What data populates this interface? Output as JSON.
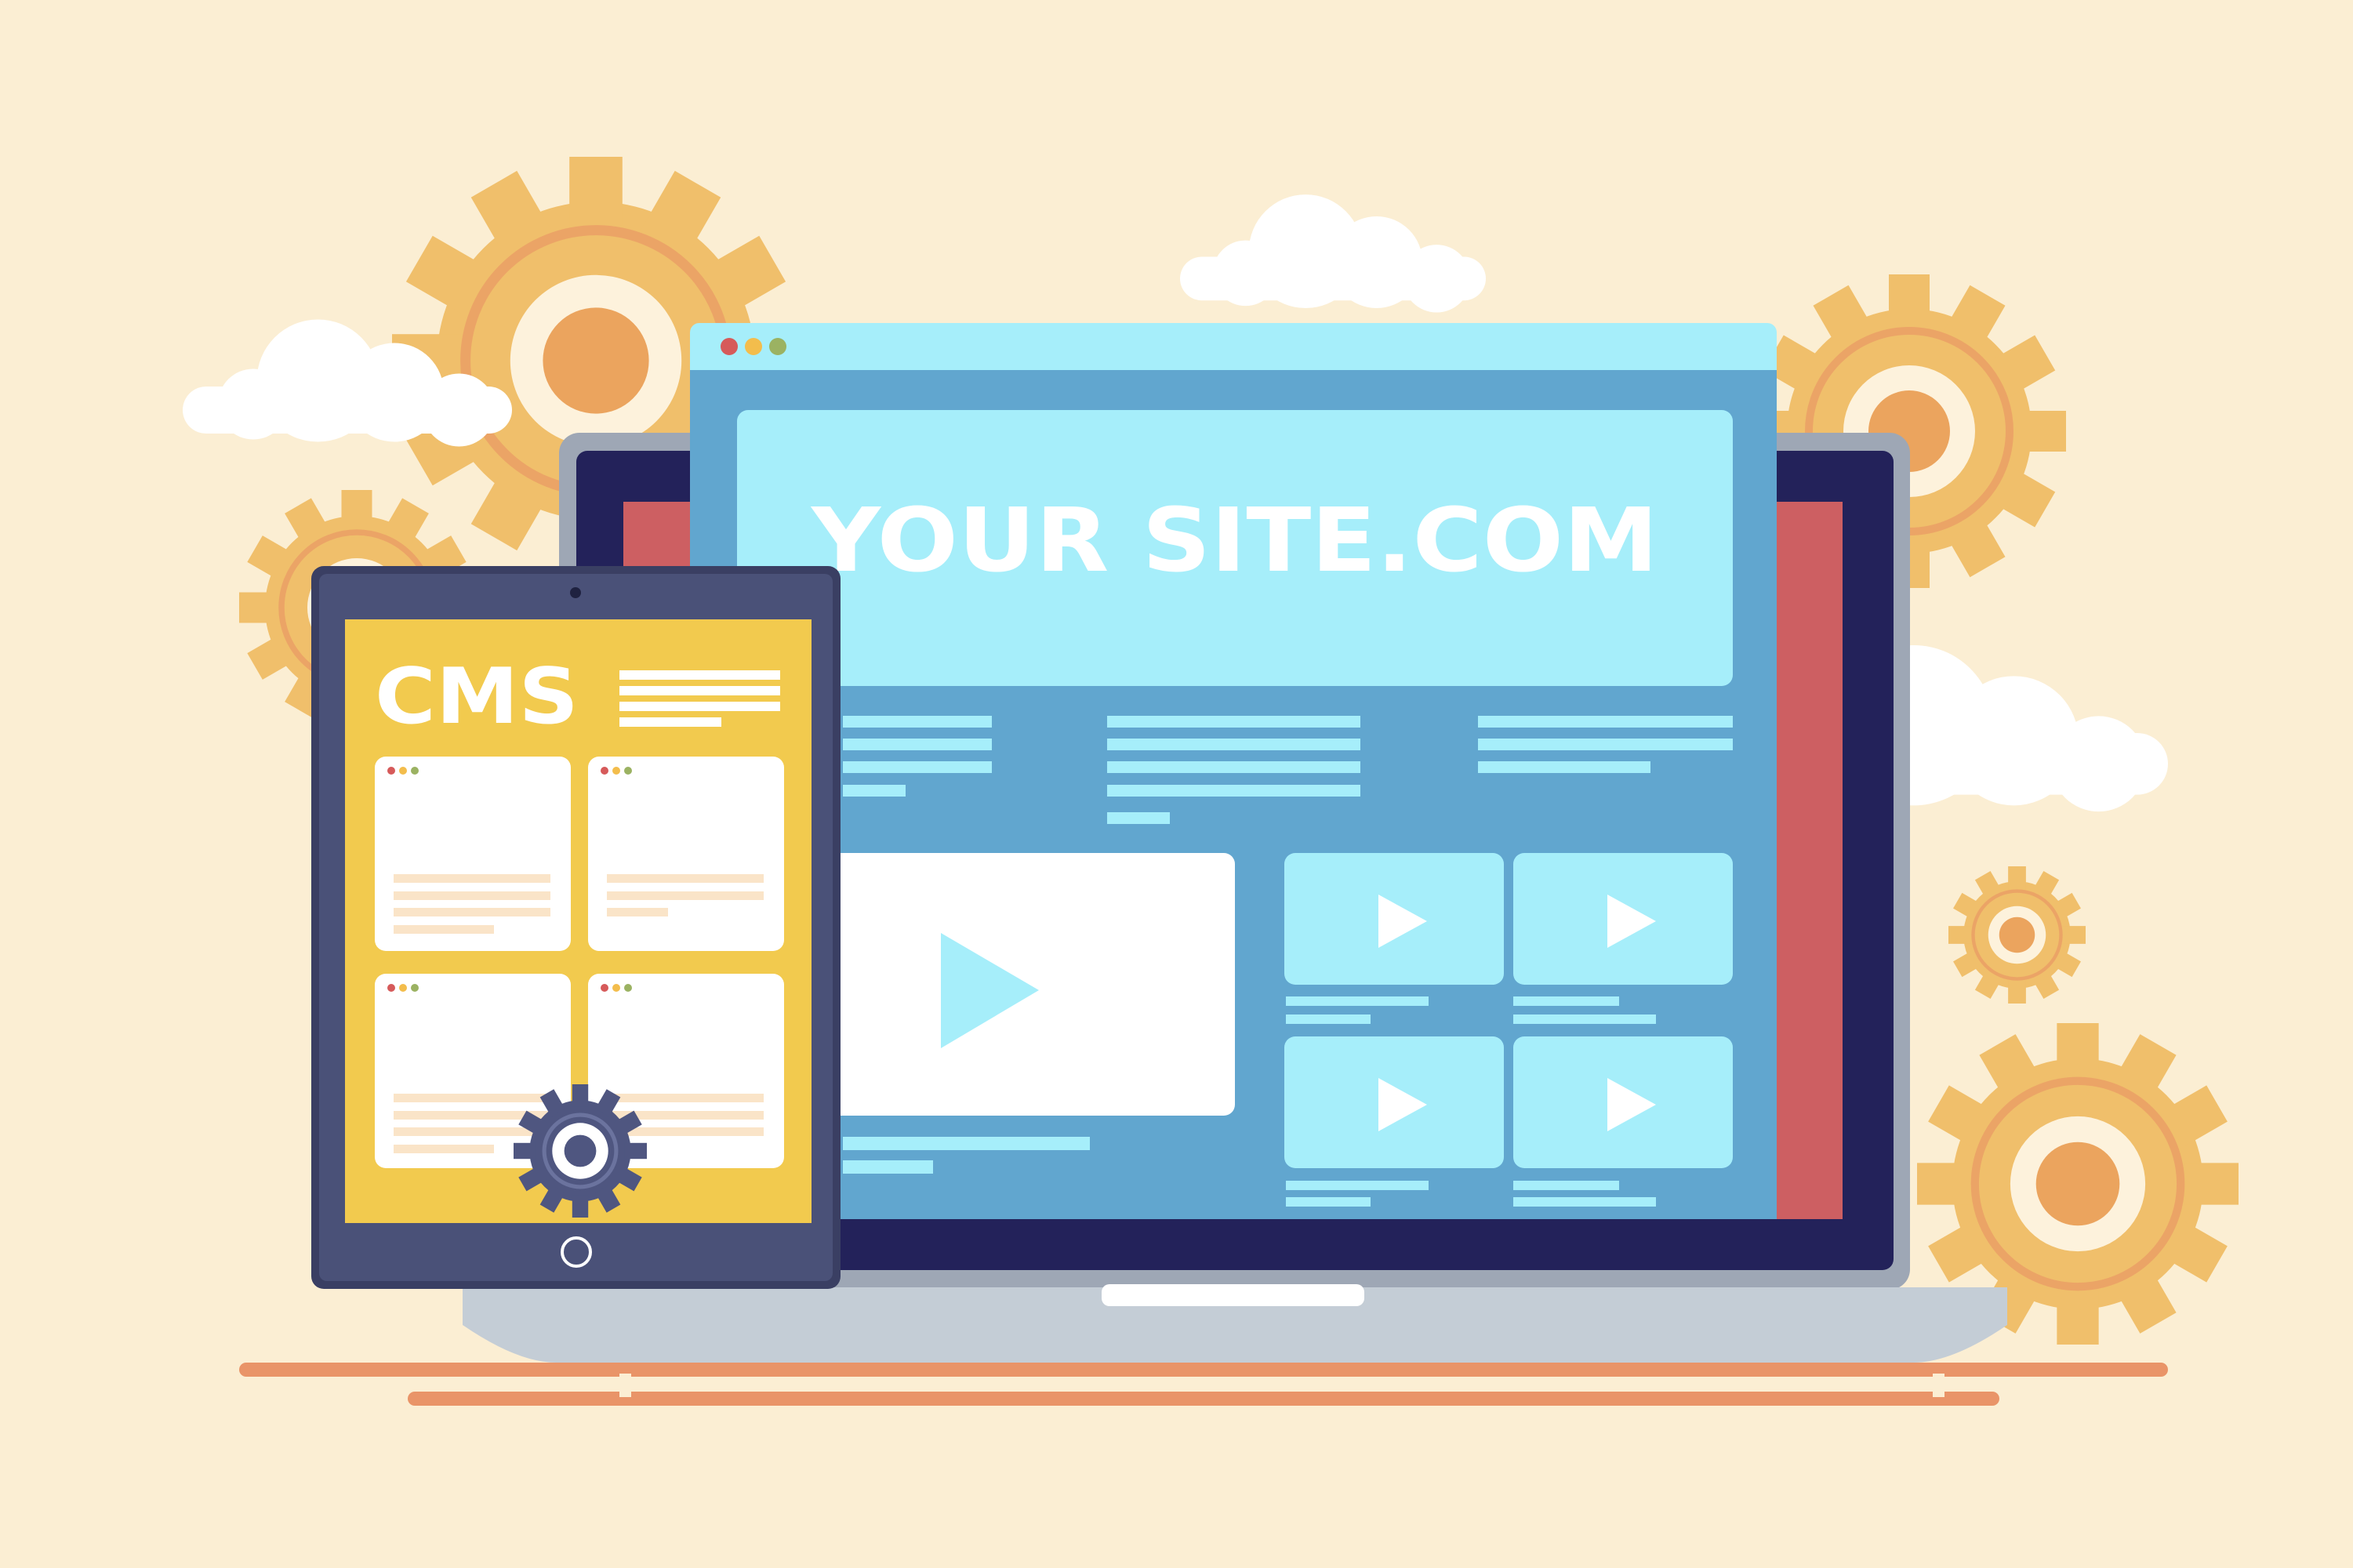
{
  "website": {
    "title": "YOUR SITE.COM"
  },
  "tablet": {
    "title": "CMS"
  },
  "colors": {
    "background": "#fbeed3",
    "gear_primary": "#f0bf6b",
    "gear_ring": "#eba466",
    "gear_hub": "#eba45e",
    "cloud": "#ffffff",
    "browser_light": "#a6eefa",
    "browser_mid": "#61a6cf",
    "laptop_bezel": "#23225a",
    "laptop_frame": "#9ea7b5",
    "laptop_base": "#c4cdd6",
    "screen_red": "#cd5f62",
    "tablet_frame": "#3a3f63",
    "tablet_bezel": "#4a5178",
    "tablet_screen": "#f2ca4e",
    "cms_card": "#ffffff",
    "cms_lines": "#fae4c8",
    "cms_gear": "#4f5680",
    "ground_line": "#e99468",
    "dot_red": "#d65a5a",
    "dot_yellow": "#f3bd4c",
    "dot_green": "#9bb262"
  },
  "browser": {
    "window_dots": [
      "dot_red",
      "dot_yellow",
      "dot_green"
    ]
  },
  "icons": [
    "gear-icon",
    "cloud-icon",
    "play-icon",
    "camera-icon",
    "home-button-icon"
  ]
}
